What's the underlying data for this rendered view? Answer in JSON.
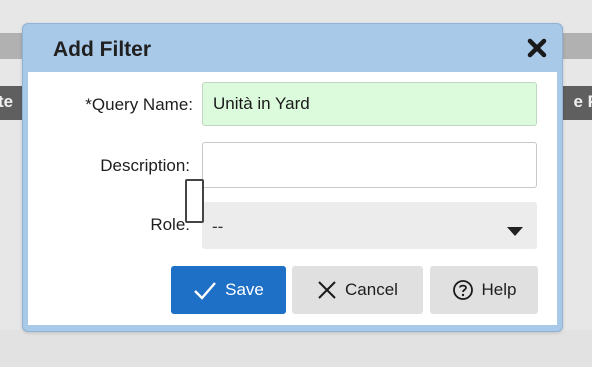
{
  "background": {
    "left_fragment": "te",
    "right_fragment": "e F"
  },
  "dialog": {
    "title": "Add Filter",
    "close_icon": "close-icon",
    "fields": {
      "query_name_label": "*Query Name:",
      "query_name_value": "Unità in Yard",
      "description_label": "Description:",
      "description_value": "",
      "role_label": "Role:",
      "role_value": "--"
    },
    "buttons": {
      "save": "Save",
      "cancel": "Cancel",
      "help": "Help"
    }
  },
  "colors": {
    "title_bar": "#a9c9e8",
    "save_button": "#1e6fc6",
    "query_field_bg": "#dcfadc"
  }
}
